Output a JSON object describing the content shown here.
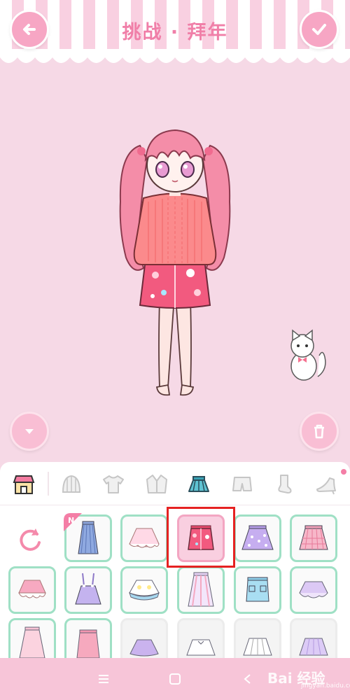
{
  "header": {
    "title": "挑战 · 拜年",
    "back_icon": "arrow-left-icon",
    "confirm_icon": "checkmark-icon"
  },
  "stage": {
    "hide_panel_icon": "chevron-down-icon",
    "trash_icon": "trash-icon",
    "pet": "white-cat"
  },
  "categories": [
    {
      "name": "shop",
      "icon": "shop-icon"
    },
    {
      "name": "hat",
      "icon": "hat-icon"
    },
    {
      "name": "top",
      "icon": "tshirt-icon"
    },
    {
      "name": "coat",
      "icon": "jacket-icon"
    },
    {
      "name": "skirt",
      "icon": "skirt-icon",
      "selected": true
    },
    {
      "name": "shorts",
      "icon": "shorts-icon"
    },
    {
      "name": "socks",
      "icon": "sock-icon"
    },
    {
      "name": "shoes",
      "icon": "heel-shoe-icon"
    }
  ],
  "items": {
    "reset_icon": "reset-icon",
    "new_badge": "N",
    "selected_item": "pink-print-skirt"
  },
  "navbar": {
    "menu_icon": "menu-icon",
    "home_icon": "home-square-icon",
    "back_icon": "nav-back-icon"
  },
  "watermark": {
    "text": "Bai 经验",
    "sub": "jingyan.baidu.com"
  },
  "colors": {
    "accent": "#f7a6c4",
    "background": "#f6d9e6",
    "item_border": "#9fe0c5",
    "highlight": "#e52222"
  }
}
